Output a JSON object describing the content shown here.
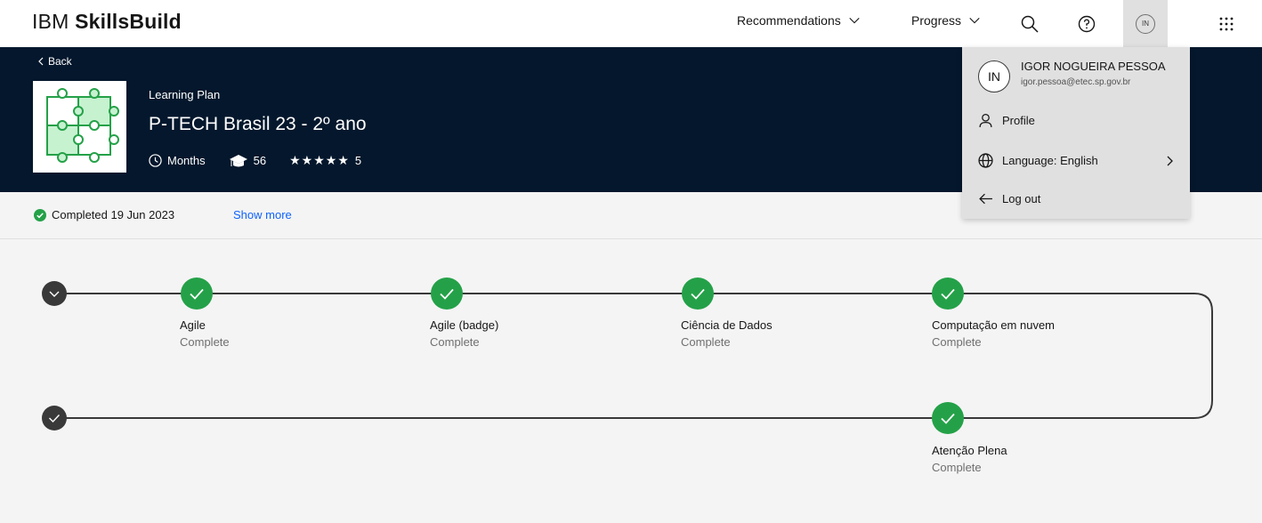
{
  "nav": {
    "brand_light": "IBM",
    "brand_bold": "SkillsBuild",
    "recommendations": "Recommendations",
    "progress": "Progress",
    "avatar_initials": "IN"
  },
  "hero": {
    "back": "Back",
    "eyebrow": "Learning Plan",
    "title": "P-TECH Brasil 23 - 2º ano",
    "duration": "Months",
    "learners": "56",
    "stars": "★★★★★",
    "rating": "5"
  },
  "status": {
    "completed": "Completed 19 Jun 2023",
    "show_more": "Show more"
  },
  "timeline": {
    "row1": [
      {
        "title": "Agile",
        "status": "Complete"
      },
      {
        "title": "Agile (badge)",
        "status": "Complete"
      },
      {
        "title": "Ciência de Dados",
        "status": "Complete"
      },
      {
        "title": "Computação em nuvem",
        "status": "Complete"
      }
    ],
    "row2": [
      {
        "title": "Atenção Plena",
        "status": "Complete"
      }
    ]
  },
  "menu": {
    "initials": "IN",
    "name": "IGOR NOGUEIRA PESSOA",
    "email": "igor.pessoa@etec.sp.gov.br",
    "profile": "Profile",
    "language": "Language: English",
    "logout": "Log out"
  },
  "colors": {
    "hero_bg": "#04172c",
    "complete_green": "#24a148",
    "link_blue": "#0f62fe",
    "dark_node": "#393939"
  }
}
